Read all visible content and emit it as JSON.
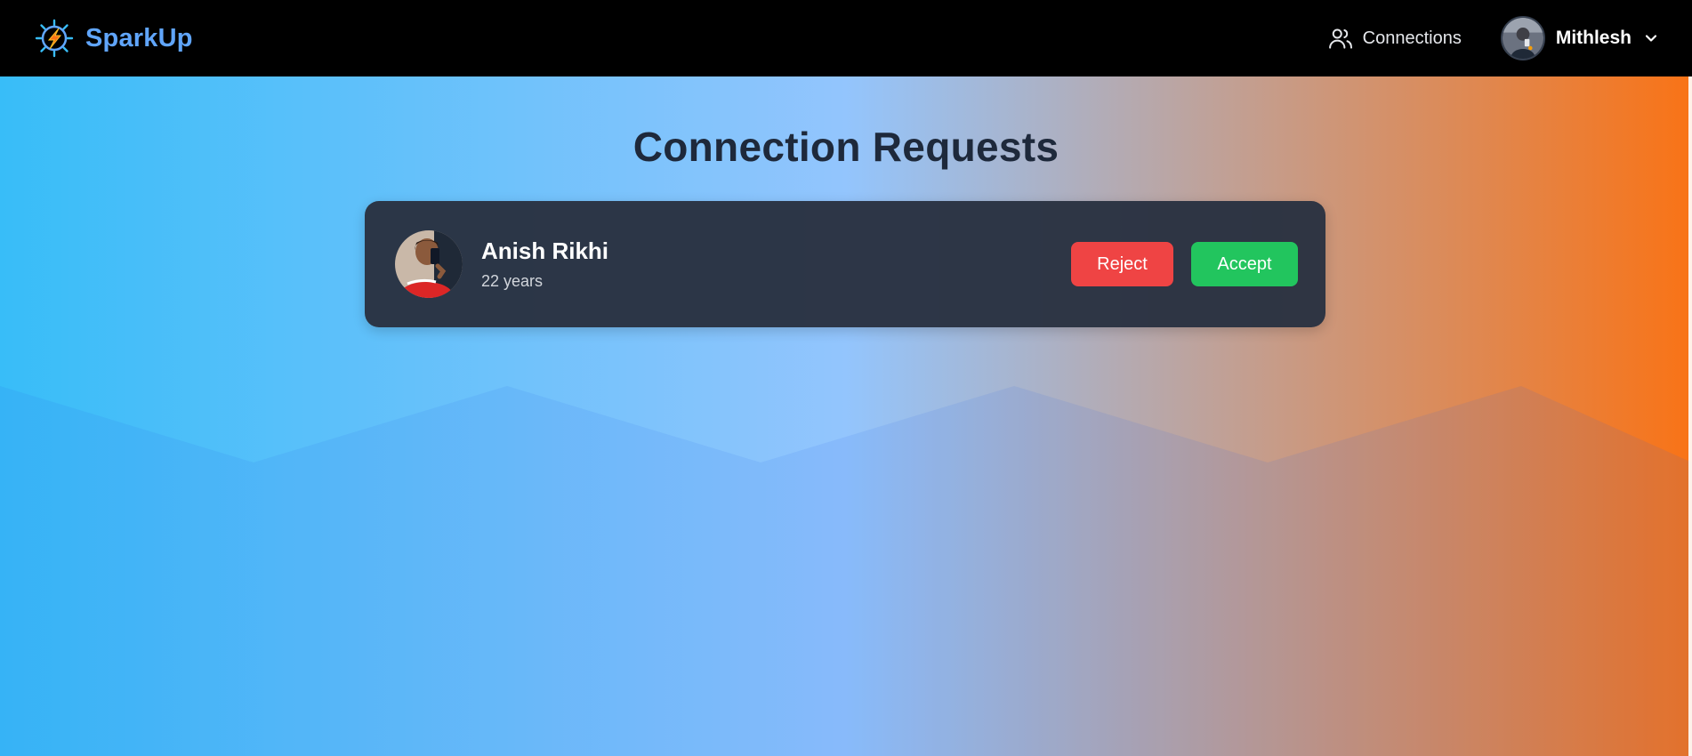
{
  "navbar": {
    "brand_name": "SparkUp",
    "brand_icon": "sparkup-logo-icon",
    "connections_label": "Connections",
    "connections_icon": "users-icon",
    "user_name": "Mithlesh",
    "dropdown_icon": "chevron-down-icon"
  },
  "page": {
    "title": "Connection Requests"
  },
  "requests": [
    {
      "name": "Anish Rikhi",
      "age_text": "22 years",
      "reject_label": "Reject",
      "accept_label": "Accept"
    }
  ],
  "colors": {
    "navbar_bg": "#000000",
    "brand": "#60a5fa",
    "card_bg": "#293241",
    "reject": "#ef4444",
    "accept": "#22c55e",
    "gradient_start": "#38bdf8",
    "gradient_mid": "#93c5fd",
    "gradient_end": "#f97316"
  }
}
